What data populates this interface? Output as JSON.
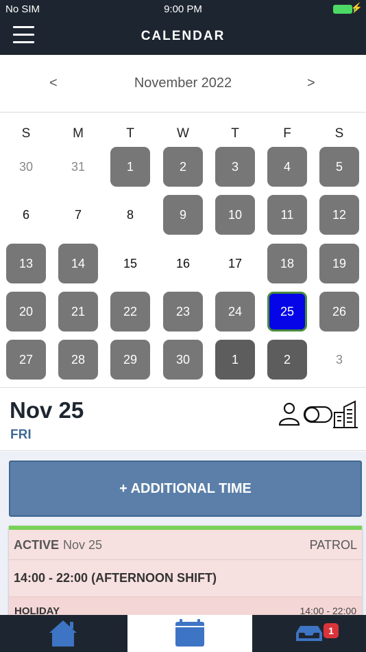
{
  "status_bar": {
    "carrier": "No SIM",
    "time": "9:00 PM"
  },
  "header": {
    "title": "CALENDAR"
  },
  "month_nav": {
    "prev": "<",
    "label": "November 2022",
    "next": ">"
  },
  "weekdays": [
    "S",
    "M",
    "T",
    "W",
    "T",
    "F",
    "S"
  ],
  "days": [
    {
      "label": "30",
      "state": "other"
    },
    {
      "label": "31",
      "state": "other"
    },
    {
      "label": "1",
      "state": "shift"
    },
    {
      "label": "2",
      "state": "shift"
    },
    {
      "label": "3",
      "state": "shift"
    },
    {
      "label": "4",
      "state": "shift"
    },
    {
      "label": "5",
      "state": "shift"
    },
    {
      "label": "6",
      "state": "plain"
    },
    {
      "label": "7",
      "state": "plain"
    },
    {
      "label": "8",
      "state": "plain"
    },
    {
      "label": "9",
      "state": "shift"
    },
    {
      "label": "10",
      "state": "shift"
    },
    {
      "label": "11",
      "state": "shift"
    },
    {
      "label": "12",
      "state": "shift"
    },
    {
      "label": "13",
      "state": "shift"
    },
    {
      "label": "14",
      "state": "shift"
    },
    {
      "label": "15",
      "state": "plain"
    },
    {
      "label": "16",
      "state": "plain"
    },
    {
      "label": "17",
      "state": "plain"
    },
    {
      "label": "18",
      "state": "shift"
    },
    {
      "label": "19",
      "state": "shift"
    },
    {
      "label": "20",
      "state": "shift"
    },
    {
      "label": "21",
      "state": "shift"
    },
    {
      "label": "22",
      "state": "shift"
    },
    {
      "label": "23",
      "state": "shift"
    },
    {
      "label": "24",
      "state": "shift"
    },
    {
      "label": "25",
      "state": "selected"
    },
    {
      "label": "26",
      "state": "shift"
    },
    {
      "label": "27",
      "state": "shift"
    },
    {
      "label": "28",
      "state": "shift"
    },
    {
      "label": "29",
      "state": "shift"
    },
    {
      "label": "30",
      "state": "shift"
    },
    {
      "label": "1",
      "state": "dark"
    },
    {
      "label": "2",
      "state": "dark"
    },
    {
      "label": "3",
      "state": "other"
    }
  ],
  "detail": {
    "date": "Nov 25",
    "weekday": "FRI",
    "icons": [
      "person-icon",
      "toggle-icon",
      "buildings-icon"
    ]
  },
  "add_button": {
    "label": "+ ADDITIONAL TIME"
  },
  "shift_card": {
    "status": "ACTIVE",
    "date": "Nov 25",
    "type": "PATROL",
    "time": "14:00 - 22:00 (AFTERNOON SHIFT)",
    "sub_label": "HOLIDAY",
    "sub_time": "14:00 - 22:00"
  },
  "tabbar": {
    "tabs": [
      "home-icon",
      "calendar-icon",
      "inbox-icon"
    ],
    "inbox_badge": "1"
  },
  "colors": {
    "header_bg": "#1d2630",
    "shift_day": "#777777",
    "selected_day": "#0505e8",
    "selected_border": "#4a8a3a",
    "accent_blue": "#3e6a95",
    "card_active": "#78d25a",
    "badge": "#d9343a"
  }
}
